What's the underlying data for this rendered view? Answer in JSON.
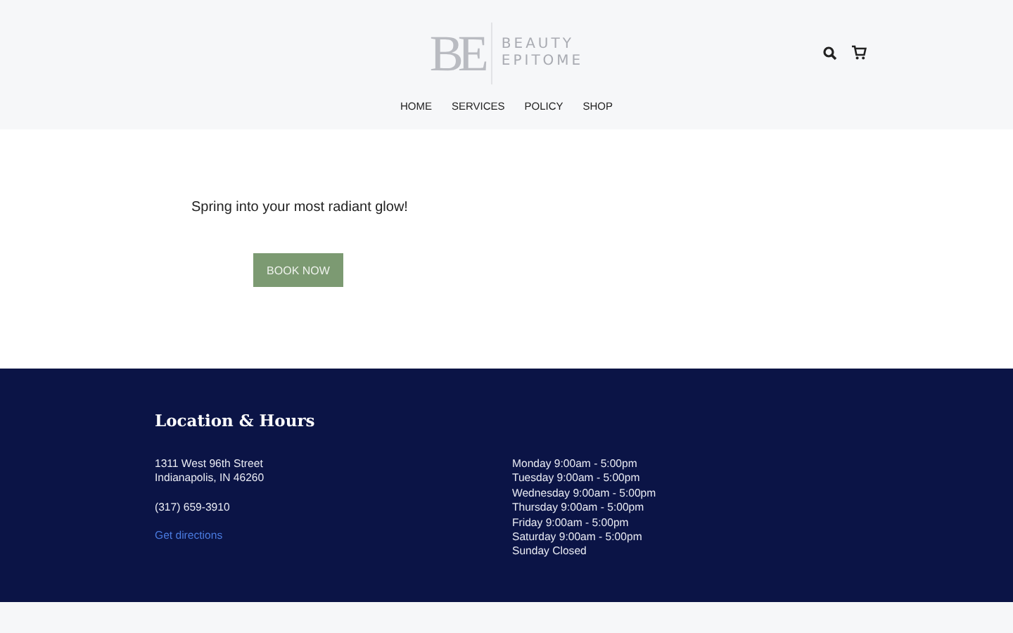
{
  "header": {
    "logo": {
      "monogram": "BE",
      "line_1": "BEAUTY",
      "line_2": "EPITOME"
    },
    "nav": [
      {
        "label": "HOME"
      },
      {
        "label": "SERVICES"
      },
      {
        "label": "POLICY"
      },
      {
        "label": "SHOP"
      }
    ]
  },
  "hero": {
    "tagline": "Spring into your most radiant glow!",
    "button": "BOOK NOW"
  },
  "footer": {
    "title": "Location & Hours",
    "address": [
      "1311 West 96th Street",
      "Indianapolis, IN 46260"
    ],
    "phone": "(317) 659-3910",
    "link": "Get directions",
    "hours": [
      "Monday 9:00am - 5:00pm",
      "Tuesday 9:00am - 5:00pm",
      "Wednesday 9:00am - 5:00pm",
      "Thursday 9:00am - 5:00pm",
      "Friday 9:00am - 5:00pm",
      "Saturday 9:00am - 5:00pm",
      "Sunday Closed"
    ]
  }
}
